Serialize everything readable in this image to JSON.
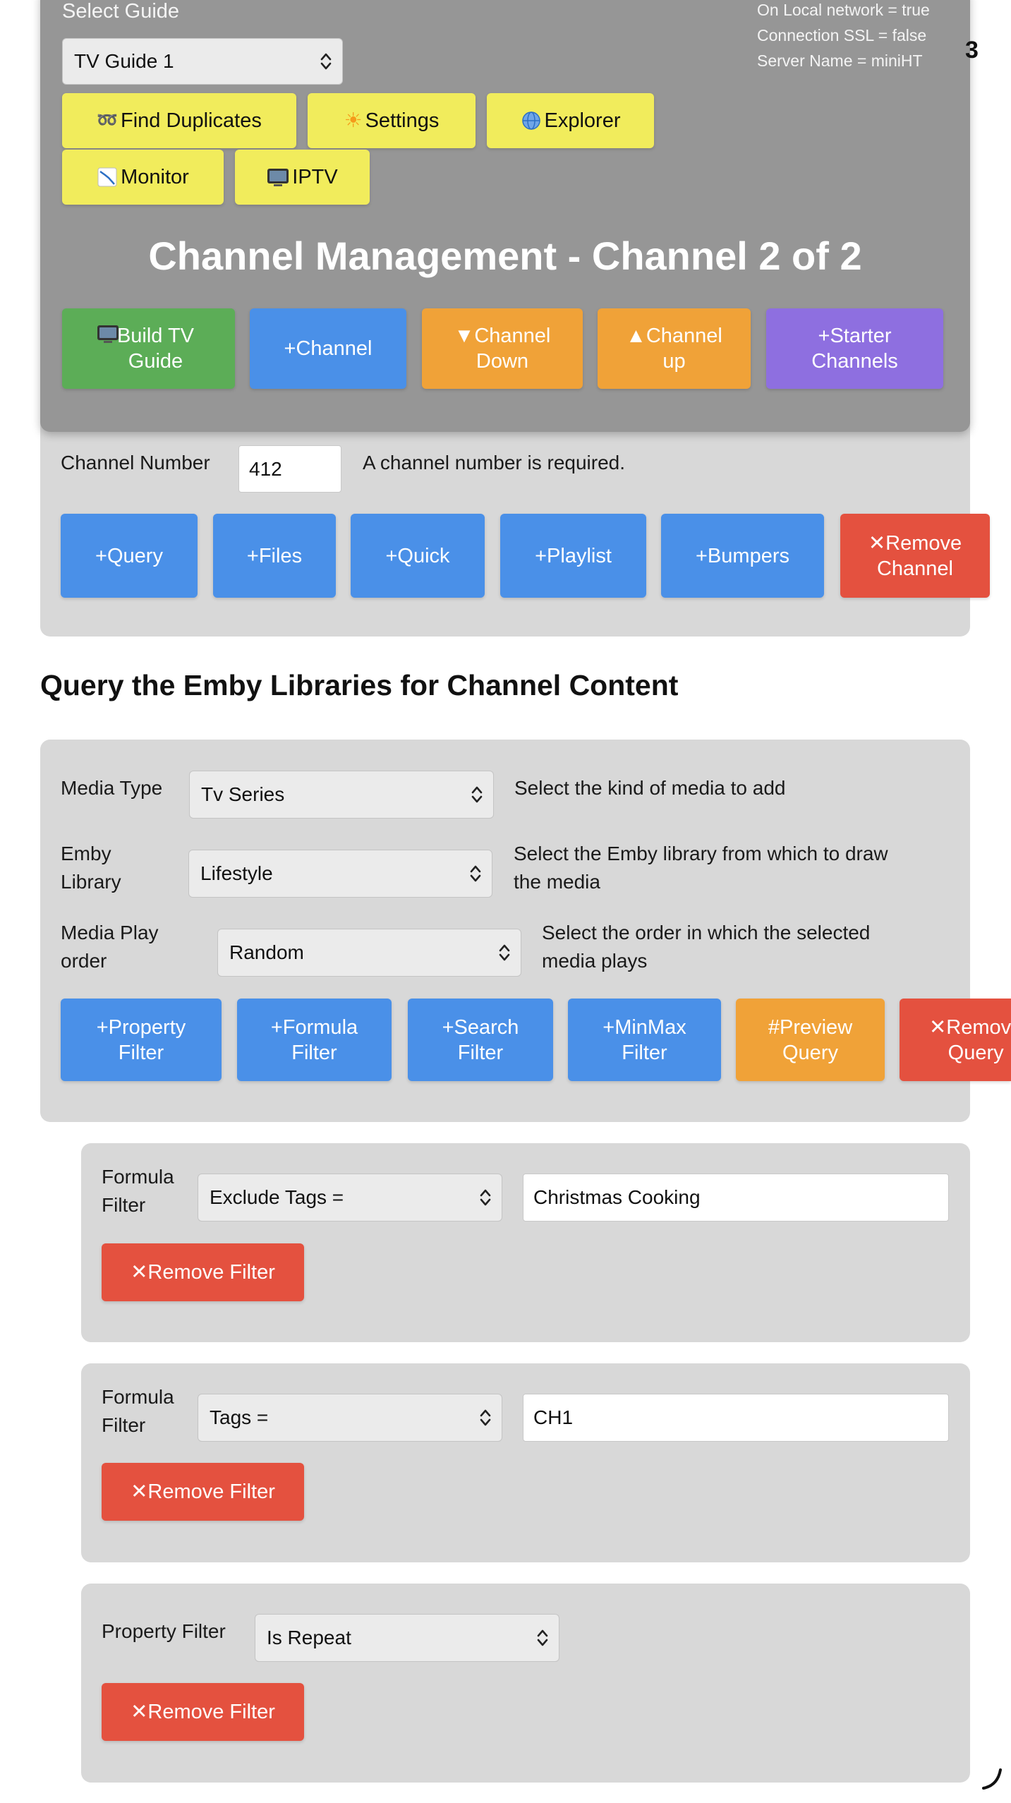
{
  "overlay": {
    "select_guide_label": "Select Guide",
    "guide_select_value": "TV Guide 1",
    "status": {
      "local_network": "On Local network = true",
      "ssl": "Connection SSL = false",
      "server_name": "Server Name = miniHT"
    },
    "edge_glyph": "3",
    "nav_buttons": {
      "find_duplicates": "Find Duplicates",
      "settings": "Settings",
      "explorer": "Explorer",
      "monitor": "Monitor",
      "iptv": "IPTV"
    },
    "title": "Channel Management - Channel 2 of 2",
    "action_buttons": {
      "build_guide": "Build TV\nGuide",
      "add_channel": "+Channel",
      "channel_down": "▼Channel\nDown",
      "channel_up": "▲Channel\nup",
      "starter_channels": "+Starter\nChannels"
    },
    "icons": {
      "find_duplicates": "glasses-icon",
      "settings": "sun-icon",
      "explorer": "globe-icon",
      "monitor": "chart-down-icon",
      "iptv": "tv-icon",
      "build_guide": "tv-icon"
    }
  },
  "channel": {
    "number_label": "Channel Number",
    "number_value": "412",
    "number_hint": "A channel number is required.",
    "buttons": {
      "query": "+Query",
      "files": "+Files",
      "quick": "+Quick",
      "playlist": "+Playlist",
      "bumpers": "+Bumpers",
      "remove_channel": "✕Remove\nChannel"
    }
  },
  "query": {
    "heading": "Query the Emby Libraries for Channel Content",
    "media_type_label": "Media Type",
    "media_type_value": "Tv Series",
    "media_type_hint": "Select the kind of media to add",
    "library_label": "Emby\nLibrary",
    "library_value": "Lifestyle",
    "library_hint": "Select the Emby library from which to draw\nthe media",
    "play_order_label": "Media Play\norder",
    "play_order_value": "Random",
    "play_order_hint": "Select the order in which the selected\nmedia plays",
    "buttons": {
      "property_filter": "+Property\nFilter",
      "formula_filter": "+Formula\nFilter",
      "search_filter": "+Search\nFilter",
      "minmax_filter": "+MinMax\nFilter",
      "preview_query": "#Preview\nQuery",
      "remove_query": "✕Remove\nQuery"
    }
  },
  "filters": [
    {
      "label": "Formula\nFilter",
      "select_value": "Exclude Tags =",
      "input_value": "Christmas Cooking",
      "remove_label": "✕Remove Filter"
    },
    {
      "label": "Formula\nFilter",
      "select_value": "Tags =",
      "input_value": "CH1",
      "remove_label": "✕Remove Filter"
    },
    {
      "label": "Property Filter",
      "select_value": "Is Repeat",
      "remove_label": "✕Remove Filter"
    }
  ],
  "colors": {
    "yellow": "#f1ec5c",
    "green": "#5cad57",
    "blue": "#4a90e8",
    "orange": "#f0a238",
    "purple": "#8e6fe0",
    "red": "#e4513f"
  }
}
